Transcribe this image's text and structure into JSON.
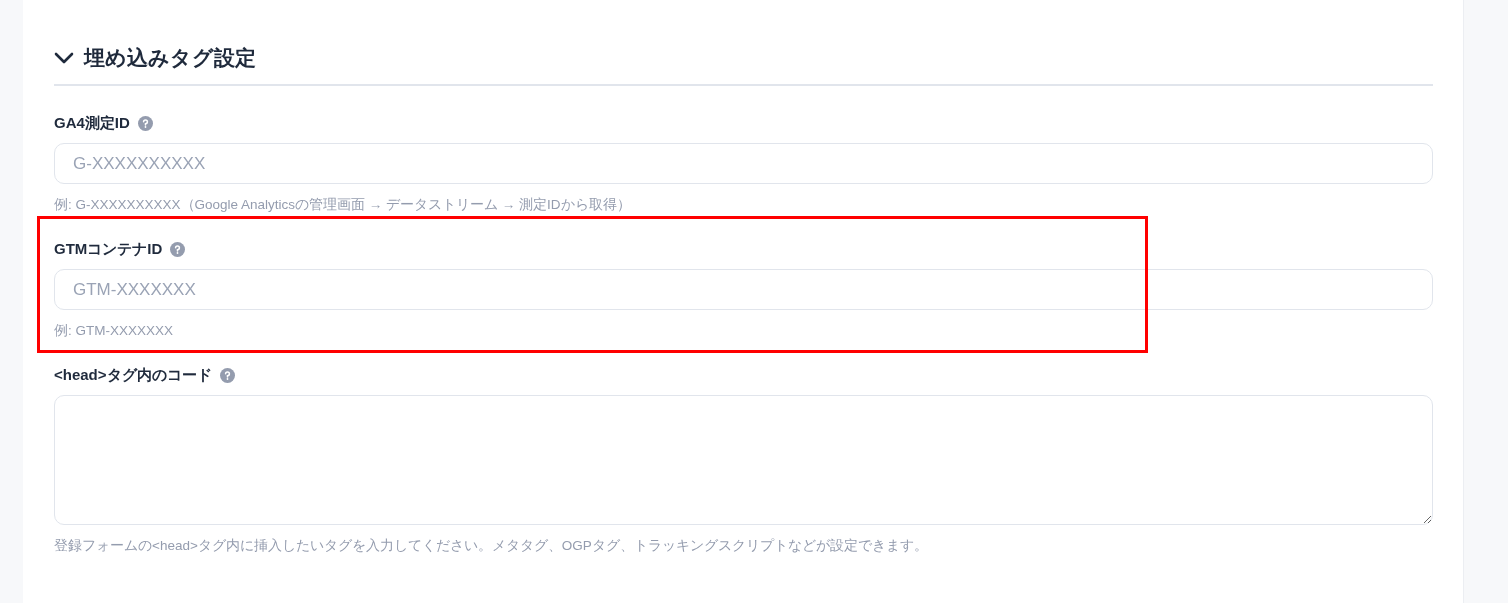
{
  "section": {
    "title": "埋め込みタグ設定",
    "expanded": true
  },
  "fields": [
    {
      "kind": "input",
      "label": "GA4測定ID",
      "placeholder": "G-XXXXXXXXXX",
      "hint": "例: G-XXXXXXXXXX（Google Analyticsの管理画面 → データストリーム → 測定IDから取得）",
      "highlighted": false
    },
    {
      "kind": "input",
      "label": "GTMコンテナID",
      "placeholder": "GTM-XXXXXXX",
      "hint": "例: GTM-XXXXXXX",
      "highlighted": true
    },
    {
      "kind": "textarea",
      "label": "<head>タグ内のコード",
      "hint": "登録フォームの<head>タグ内に挿入したいタグを入力してください。メタタグ、OGPタグ、トラッキングスクリプトなどが設定できます。",
      "highlighted": false
    }
  ]
}
